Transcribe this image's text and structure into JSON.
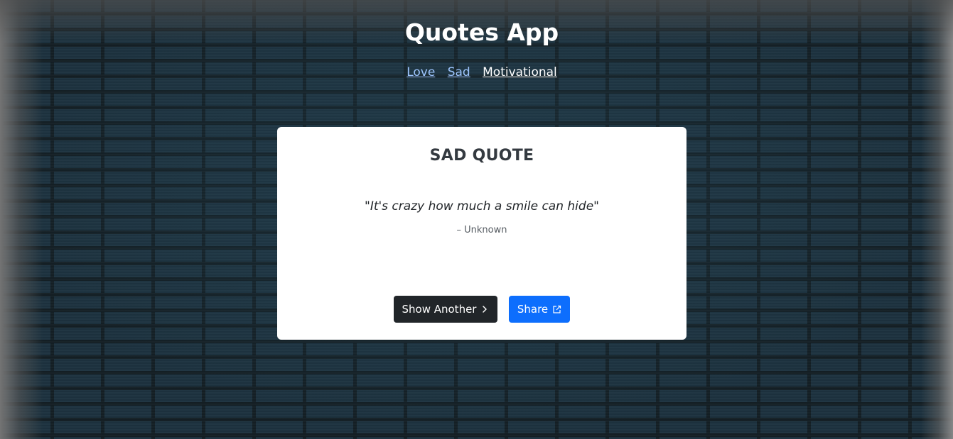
{
  "header": {
    "title": "Quotes App"
  },
  "nav": {
    "links": [
      {
        "label": "Love"
      },
      {
        "label": "Sad"
      },
      {
        "label": "Motivational"
      }
    ]
  },
  "card": {
    "title": "SAD QUOTE",
    "quote": "\"It's crazy how much a smile can hide\"",
    "author": "– Unknown",
    "show_another_label": "Show Another",
    "share_label": "Share"
  },
  "icons": {
    "show_another": "chevron-right-icon",
    "share": "external-link-icon"
  },
  "colors": {
    "card_title": "#343a40",
    "dark_button": "#212529",
    "primary_button": "#0d6efd",
    "visited_link": "#9ec5fe",
    "active_link": "#ffffff"
  }
}
